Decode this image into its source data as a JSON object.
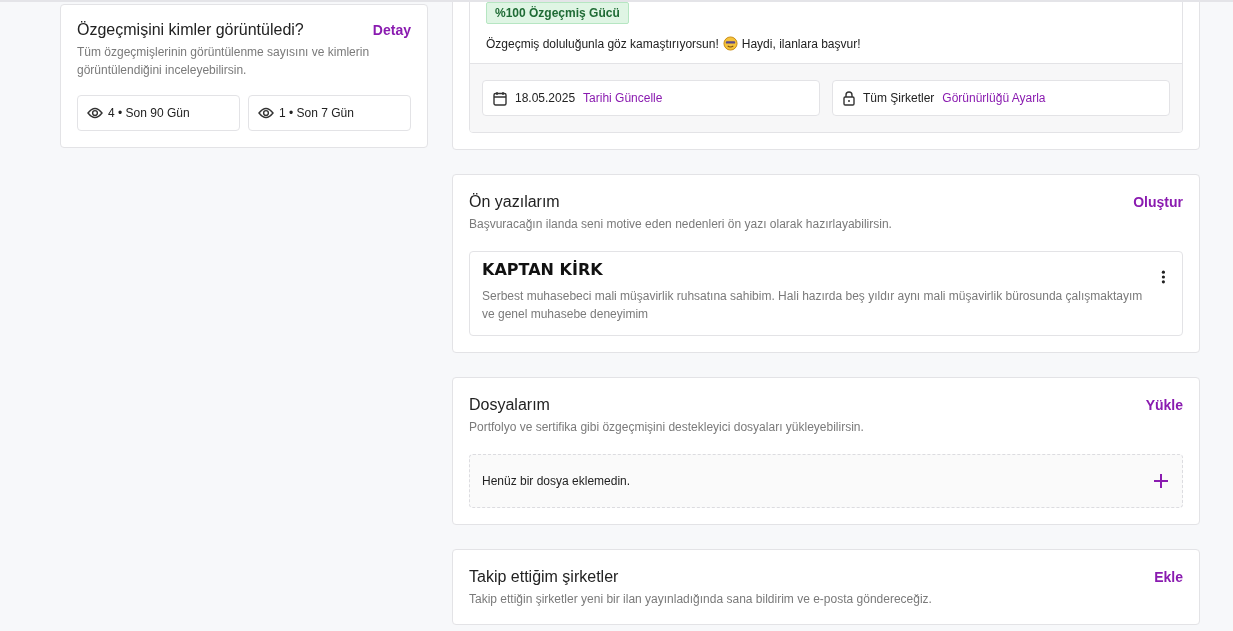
{
  "views_card": {
    "title": "Özgeçmişini kimler görüntüledi?",
    "action": "Detay",
    "description": "Tüm özgeçmişlerinin görüntülenme sayısını ve kimlerin görüntülendiğini inceleyebilirsin.",
    "stats": [
      {
        "text": "4 • Son 90 Gün"
      },
      {
        "text": "1 • Son 7 Gün"
      }
    ]
  },
  "resume_card": {
    "badge": "%100 Özgeçmiş Gücü",
    "message_before": "Özgeçmiş doluluğunla göz kamaştırıyorsun!",
    "message_after": "Haydi, ilanlara başvur!",
    "fields": [
      {
        "kind": "date",
        "value": "18.05.2025",
        "action": "Tarihi Güncelle"
      },
      {
        "kind": "visibility",
        "value": "Tüm Şirketler",
        "action": "Görünürlüğü Ayarla"
      }
    ]
  },
  "sections": [
    {
      "kind": "cover_letters",
      "title": "Ön yazılarım",
      "action": "Oluştur",
      "description": "Başvuracağın ilanda seni motive eden nedenleri ön yazı olarak hazırlayabilirsin.",
      "items": [
        {
          "title": "KAPTAN KİRK",
          "body": "Serbest muhasebeci mali müşavirlik ruhsatına sahibim. Hali hazırda beş yıldır aynı mali müşavirlik bürosunda çalışmaktayım ve genel muhasebe deneyimim"
        }
      ]
    },
    {
      "kind": "files",
      "title": "Dosyalarım",
      "action": "Yükle",
      "description": "Portfolyo ve sertifika gibi özgeçmişini destekleyici dosyaları yükleyebilirsin.",
      "empty_text": "Henüz bir dosya eklemedin."
    },
    {
      "kind": "companies",
      "title": "Takip ettiğim şirketler",
      "action": "Ekle",
      "description": "Takip ettiğin şirketler yeni bir ilan yayınladığında sana bildirim ve e-posta göndereceğiz."
    }
  ]
}
